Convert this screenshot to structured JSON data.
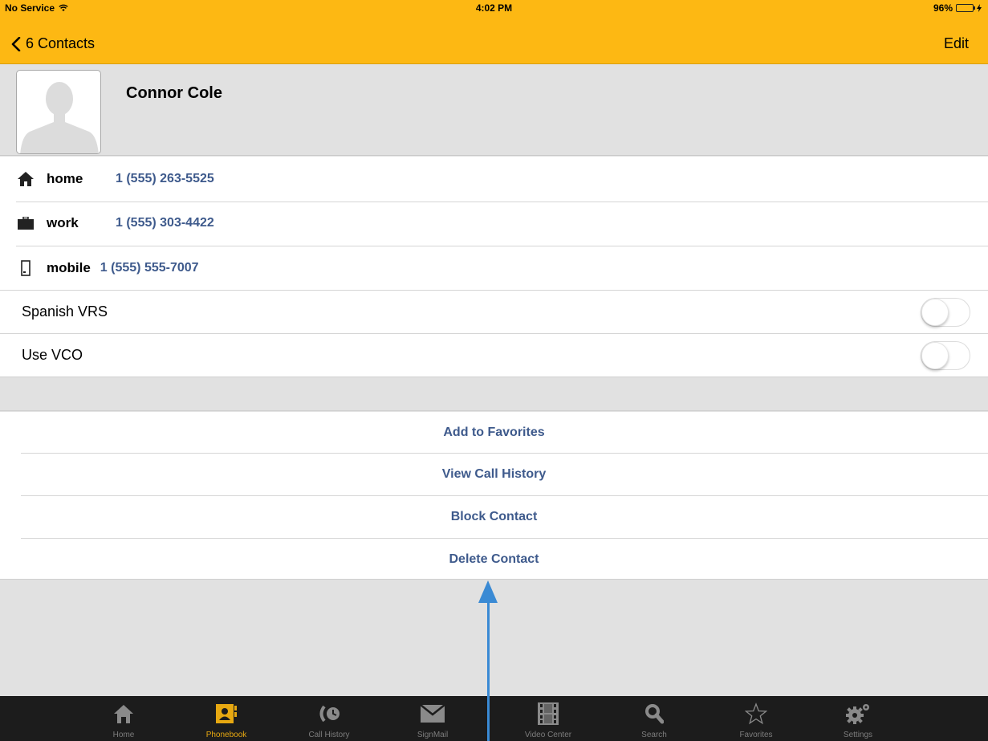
{
  "status_bar": {
    "carrier": "No Service",
    "time": "4:02 PM",
    "battery": "96%",
    "battery_level": 0.96
  },
  "nav": {
    "back_label": "6 Contacts",
    "edit_label": "Edit"
  },
  "contact": {
    "name": "Connor Cole"
  },
  "phones": [
    {
      "type": "home",
      "number": "1 (555) 263-5525",
      "icon": "house-icon"
    },
    {
      "type": "work",
      "number": "1 (555) 303-4422",
      "icon": "briefcase-icon"
    },
    {
      "type": "mobile",
      "number": "1 (555) 555-7007",
      "icon": "mobile-phone-icon"
    }
  ],
  "settings": [
    {
      "label": "Spanish VRS",
      "on": false
    },
    {
      "label": "Use VCO",
      "on": false
    }
  ],
  "actions": [
    "Add to Favorites",
    "View Call History",
    "Block Contact",
    "Delete Contact"
  ],
  "tabs": [
    {
      "label": "Home",
      "icon": "house-icon",
      "active": false
    },
    {
      "label": "Phonebook",
      "icon": "phonebook-icon",
      "active": true
    },
    {
      "label": "Call History",
      "icon": "call-history-icon",
      "active": false
    },
    {
      "label": "SignMail",
      "icon": "envelope-icon",
      "active": false
    },
    {
      "label": "Video Center",
      "icon": "film-icon",
      "active": false
    },
    {
      "label": "Search",
      "icon": "magnifier-icon",
      "active": false
    },
    {
      "label": "Favorites",
      "icon": "star-icon",
      "active": false
    },
    {
      "label": "Settings",
      "icon": "gear-icon",
      "active": false
    }
  ],
  "colors": {
    "brand_yellow": "#fdb813",
    "link_blue": "#3e5a8c",
    "tab_active": "#e7a811",
    "annotation_arrow": "#3a8ad4"
  }
}
